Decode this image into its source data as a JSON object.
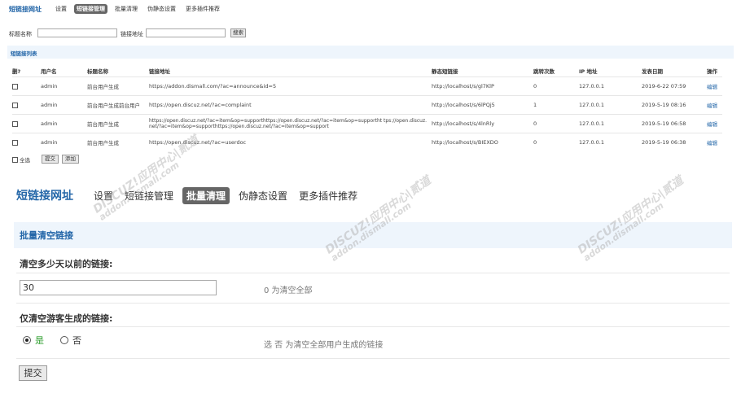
{
  "top": {
    "brand": "短链接网址",
    "nav": [
      {
        "label": "设置",
        "active": false
      },
      {
        "label": "短链接管理",
        "active": true
      },
      {
        "label": "批量清理",
        "active": false
      },
      {
        "label": "伪静态设置",
        "active": false
      },
      {
        "label": "更多插件推荐",
        "active": false
      }
    ],
    "search": {
      "title_label": "标题名称",
      "title_value": "",
      "url_label": "链接地址",
      "url_value": "",
      "button": "搜索"
    },
    "list_title": "短链接列表",
    "columns": [
      "删?",
      "用户名",
      "标题名称",
      "链接地址",
      "静态短链接",
      "跳转次数",
      "IP 地址",
      "发表日期",
      "操作"
    ],
    "rows": [
      {
        "user": "admin",
        "title": "前台用户生成",
        "url": "https://addon.dismall.com/?ac=announce&id=5",
        "short": "http://localhost/s/gl7KlP",
        "jumps": "0",
        "ip": "127.0.0.1",
        "date": "2019-6-22 07:59",
        "action": "编辑"
      },
      {
        "user": "admin",
        "title": "前台用户生成前台用户",
        "url": "https://open.discuz.net/?ac=complaint",
        "short": "http://localhost/s/6lPQj5",
        "jumps": "1",
        "ip": "127.0.0.1",
        "date": "2019-5-19 08:16",
        "action": "编辑"
      },
      {
        "user": "admin",
        "title": "前台用户生成",
        "url": "https://open.discuz.net/?ac=item&op=supporthttps://open.discuz.net/?ac=item&op=supportht tps://open.discuz.net/?ac=item&op=supporthttps://open.discuz.net/?ac=item&op=support",
        "short": "http://localhost/s/4lnRly",
        "jumps": "0",
        "ip": "127.0.0.1",
        "date": "2019-5-19 06:58",
        "action": "编辑"
      },
      {
        "user": "admin",
        "title": "前台用户生成",
        "url": "https://open.discuz.net/?ac=userdoc",
        "short": "http://localhost/s/BIEXDO",
        "jumps": "0",
        "ip": "127.0.0.1",
        "date": "2019-5-19 06:38",
        "action": "编辑"
      }
    ],
    "footer": {
      "select_all": "全选",
      "submit": "提交",
      "add": "添加"
    }
  },
  "main": {
    "brand": "短链接网址",
    "nav": [
      {
        "label": "设置",
        "active": false
      },
      {
        "label": "短链接管理",
        "active": false
      },
      {
        "label": "批量清理",
        "active": true
      },
      {
        "label": "伪静态设置",
        "active": false
      },
      {
        "label": "更多插件推荐",
        "active": false
      }
    ],
    "section_title": "批量清空链接",
    "field1": {
      "label": "清空多少天以前的链接:",
      "value": "30",
      "hint": "0 为清空全部"
    },
    "field2": {
      "label": "仅清空游客生成的链接:",
      "yes": "是",
      "no": "否",
      "selected": "yes",
      "hint": "选 否 为清空全部用户生成的链接"
    },
    "submit": "提交"
  },
  "watermark": {
    "line1": "DISCUZ!应用中心|贰道",
    "line2": "addon.dismall.com"
  },
  "colors": {
    "accent": "#2366a8",
    "active_tab": "#666666",
    "bar_bg": "#eef5fc",
    "radio_yes": "#2e9e2e"
  }
}
